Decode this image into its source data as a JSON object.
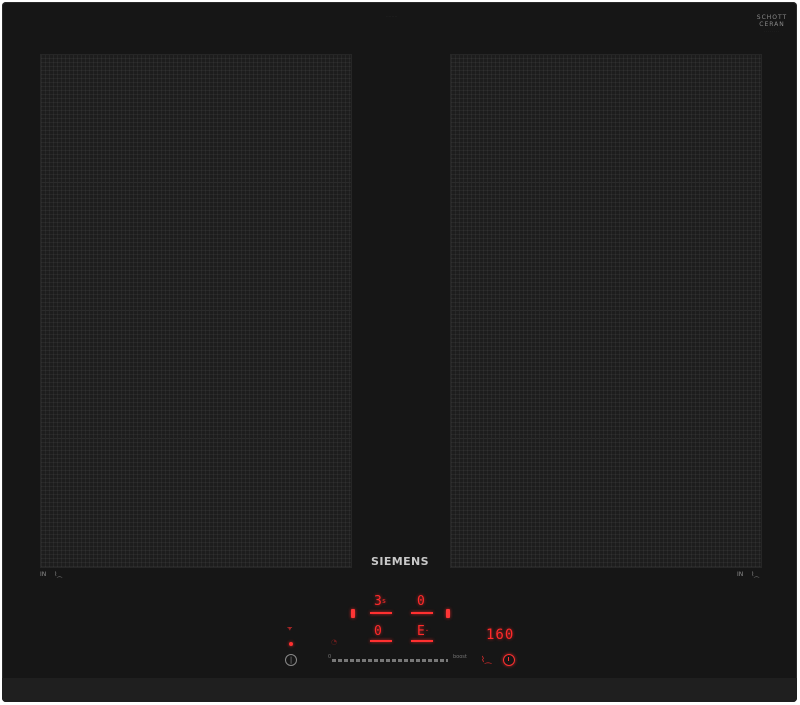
{
  "brand": "SIEMENS",
  "top_imprint": "········",
  "manufacturer": {
    "line1": "SCHOTT",
    "line2": "CERAN",
    "line3": "········"
  },
  "zone_labels": {
    "left": "IN",
    "right": "IN"
  },
  "displays": {
    "front_left_level": "3",
    "front_left_sub": "s",
    "rear_left_level": "0",
    "front_right_level": "0",
    "rear_right_level": "E",
    "rear_right_sub": "·",
    "timer": "160"
  },
  "slider": {
    "min_label": "0",
    "max_label": "boost"
  },
  "icons": {
    "power": "power-icon",
    "wifi": "wifi-indicator-icon",
    "flex": "flex-zone-icon",
    "sensor": "frying-sensor-icon",
    "timer": "timer-clock-icon"
  },
  "colors": {
    "display_red": "#ff2a2a",
    "glass": "#161616"
  }
}
